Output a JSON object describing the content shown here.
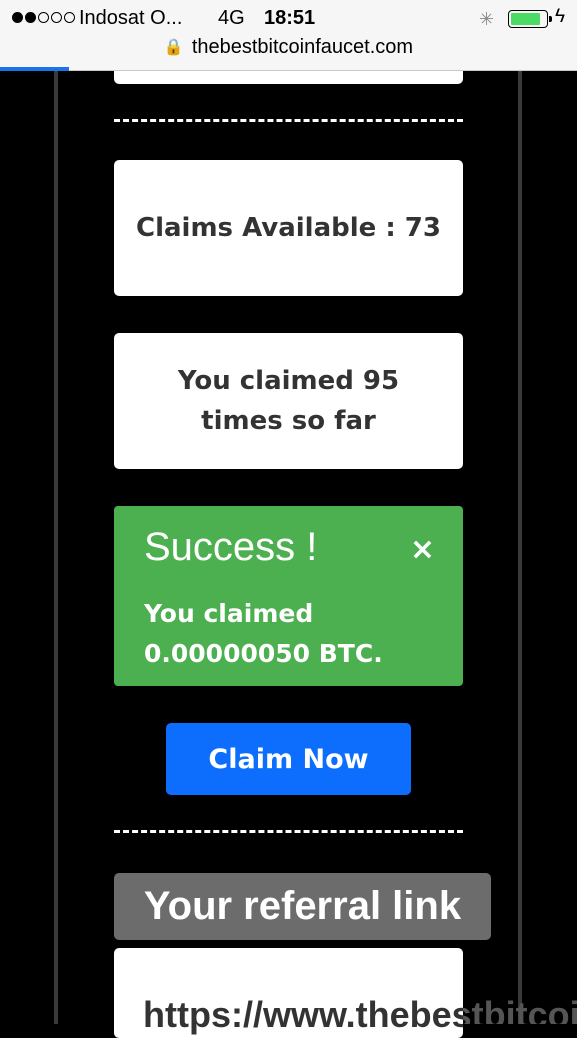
{
  "status_bar": {
    "signal_bars_filled": 2,
    "signal_bars_total": 5,
    "carrier": "Indosat O...",
    "network": "4G",
    "time": "18:51",
    "battery_level": 0.85,
    "battery_color": "#4cd964"
  },
  "address_bar": {
    "url": "thebestbitcoinfaucet.com",
    "load_progress": 0.12
  },
  "claims_card": {
    "text": "Claims Available : 73"
  },
  "claimed_card": {
    "text": "You claimed 95 times so far"
  },
  "success_alert": {
    "title": "Success !",
    "close": "×",
    "message": "You claimed 0.00000050 BTC.",
    "color": "#4caf50"
  },
  "claim_button": {
    "label": "Claim Now",
    "color": "#0d6efd"
  },
  "referral": {
    "heading": "Your referral link",
    "link": "https://www.thebestbitcoi"
  }
}
